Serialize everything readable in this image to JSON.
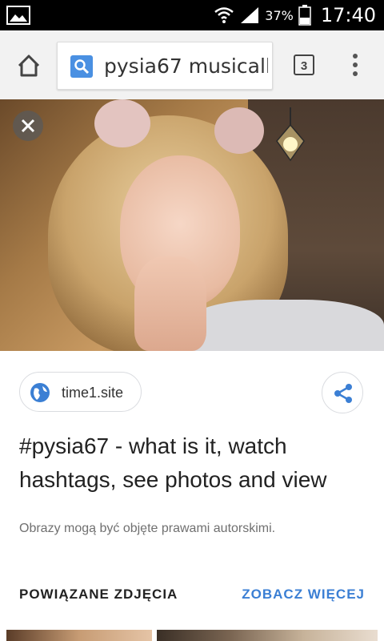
{
  "status_bar": {
    "battery_percent": "37%",
    "time": "17:40"
  },
  "toolbar": {
    "search_query": "pysia67 musicall",
    "tab_count": "3"
  },
  "result": {
    "source_site": "time1.site",
    "title": "#pysia67 - what is it, watch hashtags, see photos and view",
    "disclaimer": "Obrazy mogą być objęte prawami autorskimi."
  },
  "related": {
    "label": "POWIĄZANE ZDJĘCIA",
    "see_more": "ZOBACZ WIĘCEJ"
  },
  "colors": {
    "accent": "#3b7fd4",
    "status_bar": "#000000",
    "toolbar": "#f2f2f2"
  }
}
